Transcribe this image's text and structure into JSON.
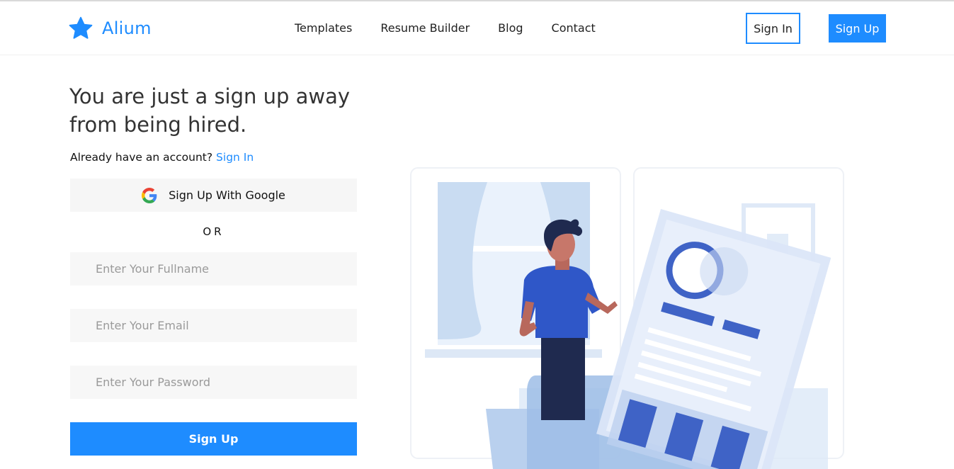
{
  "brand": {
    "name": "Alium",
    "icon": "star-icon",
    "color": "#1e8cff"
  },
  "nav": {
    "links": [
      "Templates",
      "Resume Builder",
      "Blog",
      "Contact"
    ],
    "signin_label": "Sign In",
    "signup_label": "Sign Up"
  },
  "hero": {
    "headline": "You are just a sign up away from being hired.",
    "already_text": "Already have an account?",
    "already_link": "Sign In"
  },
  "form": {
    "google_label": "Sign Up With Google",
    "google_icon": "google-icon",
    "or_text": "OR",
    "fullname_placeholder": "Enter Your Fullname",
    "email_placeholder": "Enter Your Email",
    "password_placeholder": "Enter Your Password",
    "submit_label": "Sign Up"
  },
  "illustration": {
    "name": "person-with-resume-illustration"
  }
}
